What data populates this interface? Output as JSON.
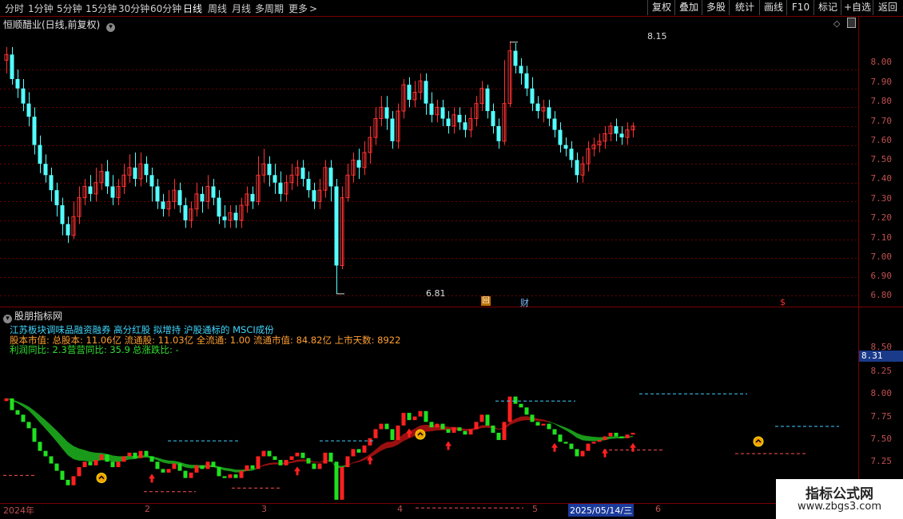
{
  "toolbar": {
    "periods": [
      "分时",
      "1分钟",
      "5分钟",
      "15分钟",
      "30分钟",
      "60分钟",
      "日线",
      "周线",
      "月线",
      "多周期",
      "更多"
    ],
    "active_period": "日线",
    "more_arrow": ">",
    "buttons": [
      "复权",
      "叠加",
      "多股",
      "统计",
      "画线",
      "F10",
      "标记",
      "+自选",
      "返回"
    ]
  },
  "main_chart": {
    "title": "恒顺醋业(日线,前复权)",
    "high_label": "8.15",
    "low_label": "6.81",
    "markers": [
      "回",
      "财",
      "$"
    ],
    "price_ticks": [
      "8.00",
      "7.90",
      "7.80",
      "7.70",
      "7.60",
      "7.50",
      "7.40",
      "7.30",
      "7.20",
      "7.10",
      "7.00",
      "6.90",
      "6.80"
    ]
  },
  "indicator": {
    "title": "股朋指标网",
    "line1": "江苏板块调味品融资融券 高分红股 拟增持 沪股通标的 MSCI成份",
    "line2": "股本市值: 总股本: 11.06亿 流通股: 11.03亿 全流通: 1.00 流通市值: 84.82亿 上市天数: 8922",
    "line3_a": "利润同比: 2.3",
    "line3_b": "营营同比: 35.9",
    "line3_c": "总涨跌比: -",
    "current_price": "8.31",
    "price_ticks": [
      "8.50",
      "8.25",
      "8.00",
      "7.75",
      "7.50",
      "7.25"
    ]
  },
  "x_axis": {
    "labels": [
      "2024年",
      "2",
      "3",
      "4",
      "5",
      "2025/05/14/三",
      "6"
    ]
  },
  "watermark": {
    "title": "指标公式网",
    "url": "www.zbgs3.com"
  },
  "colors": {
    "up": "#ff3232",
    "down": "#54ffff",
    "grid": "#6a0000",
    "axis_text": "#c05050",
    "ribbon_green": "#1a9a1a",
    "ribbon_red": "#9a1010"
  },
  "chart_data": {
    "type": "candlestick",
    "title": "恒顺醋业(日线,前复权)",
    "ylim": [
      6.78,
      8.2
    ],
    "y_ticks": [
      6.8,
      6.9,
      7.0,
      7.1,
      7.2,
      7.3,
      7.4,
      7.5,
      7.6,
      7.7,
      7.8,
      7.9,
      8.0
    ],
    "annotated_high": 8.15,
    "annotated_low": 6.81,
    "series": [
      {
        "name": "daily",
        "values": [
          [
            8.05,
            8.08,
            8.12,
            7.98
          ],
          [
            8.08,
            7.95,
            8.12,
            7.92
          ],
          [
            7.95,
            7.9,
            8.0,
            7.85
          ],
          [
            7.9,
            7.82,
            7.95,
            7.78
          ],
          [
            7.82,
            7.75,
            7.88,
            7.7
          ],
          [
            7.75,
            7.6,
            7.8,
            7.55
          ],
          [
            7.6,
            7.5,
            7.65,
            7.45
          ],
          [
            7.5,
            7.44,
            7.55,
            7.4
          ],
          [
            7.44,
            7.36,
            7.48,
            7.3
          ],
          [
            7.36,
            7.28,
            7.4,
            7.22
          ],
          [
            7.28,
            7.18,
            7.32,
            7.12
          ],
          [
            7.18,
            7.12,
            7.22,
            7.08
          ],
          [
            7.12,
            7.22,
            7.3,
            7.1
          ],
          [
            7.22,
            7.32,
            7.38,
            7.18
          ],
          [
            7.32,
            7.38,
            7.42,
            7.28
          ],
          [
            7.38,
            7.34,
            7.44,
            7.3
          ],
          [
            7.34,
            7.4,
            7.48,
            7.3
          ],
          [
            7.4,
            7.46,
            7.5,
            7.36
          ],
          [
            7.46,
            7.38,
            7.52,
            7.34
          ],
          [
            7.38,
            7.32,
            7.44,
            7.28
          ],
          [
            7.32,
            7.38,
            7.42,
            7.28
          ],
          [
            7.38,
            7.44,
            7.5,
            7.34
          ],
          [
            7.44,
            7.48,
            7.55,
            7.4
          ],
          [
            7.48,
            7.42,
            7.56,
            7.38
          ],
          [
            7.42,
            7.5,
            7.56,
            7.38
          ],
          [
            7.5,
            7.44,
            7.54,
            7.4
          ],
          [
            7.44,
            7.38,
            7.48,
            7.3
          ],
          [
            7.38,
            7.3,
            7.42,
            7.26
          ],
          [
            7.3,
            7.26,
            7.34,
            7.22
          ],
          [
            7.26,
            7.3,
            7.36,
            7.22
          ],
          [
            7.3,
            7.36,
            7.42,
            7.26
          ],
          [
            7.36,
            7.28,
            7.4,
            7.24
          ],
          [
            7.28,
            7.2,
            7.32,
            7.16
          ],
          [
            7.2,
            7.26,
            7.3,
            7.16
          ],
          [
            7.26,
            7.34,
            7.4,
            7.22
          ],
          [
            7.34,
            7.3,
            7.38,
            7.24
          ],
          [
            7.3,
            7.38,
            7.44,
            7.26
          ],
          [
            7.38,
            7.32,
            7.42,
            7.28
          ],
          [
            7.32,
            7.22,
            7.36,
            7.18
          ],
          [
            7.22,
            7.2,
            7.28,
            7.16
          ],
          [
            7.2,
            7.24,
            7.28,
            7.16
          ],
          [
            7.24,
            7.2,
            7.28,
            7.16
          ],
          [
            7.2,
            7.28,
            7.32,
            7.16
          ],
          [
            7.28,
            7.34,
            7.38,
            7.24
          ],
          [
            7.34,
            7.3,
            7.38,
            7.26
          ],
          [
            7.3,
            7.44,
            7.54,
            7.28
          ],
          [
            7.44,
            7.5,
            7.58,
            7.4
          ],
          [
            7.5,
            7.44,
            7.54,
            7.38
          ],
          [
            7.44,
            7.4,
            7.5,
            7.34
          ],
          [
            7.4,
            7.34,
            7.46,
            7.3
          ],
          [
            7.34,
            7.4,
            7.44,
            7.3
          ],
          [
            7.4,
            7.44,
            7.5,
            7.36
          ],
          [
            7.44,
            7.48,
            7.52,
            7.38
          ],
          [
            7.48,
            7.42,
            7.52,
            7.38
          ],
          [
            7.42,
            7.36,
            7.46,
            7.32
          ],
          [
            7.36,
            7.3,
            7.4,
            7.26
          ],
          [
            7.3,
            7.36,
            7.42,
            7.26
          ],
          [
            7.36,
            7.48,
            7.52,
            7.32
          ],
          [
            7.48,
            7.38,
            7.52,
            7.3
          ],
          [
            7.38,
            6.96,
            7.42,
            6.81
          ],
          [
            6.96,
            7.32,
            7.38,
            6.94
          ],
          [
            7.32,
            7.44,
            7.5,
            7.3
          ],
          [
            7.44,
            7.52,
            7.56,
            7.4
          ],
          [
            7.52,
            7.48,
            7.58,
            7.42
          ],
          [
            7.48,
            7.56,
            7.62,
            7.44
          ],
          [
            7.56,
            7.64,
            7.7,
            7.5
          ],
          [
            7.64,
            7.74,
            7.8,
            7.6
          ],
          [
            7.74,
            7.8,
            7.86,
            7.7
          ],
          [
            7.8,
            7.74,
            7.86,
            7.68
          ],
          [
            7.74,
            7.62,
            7.78,
            7.58
          ],
          [
            7.62,
            7.78,
            7.82,
            7.58
          ],
          [
            7.78,
            7.92,
            7.95,
            7.74
          ],
          [
            7.92,
            7.84,
            7.96,
            7.8
          ],
          [
            7.84,
            7.88,
            7.94,
            7.8
          ],
          [
            7.88,
            7.94,
            7.98,
            7.84
          ],
          [
            7.94,
            7.82,
            7.98,
            7.76
          ],
          [
            7.82,
            7.76,
            7.88,
            7.72
          ],
          [
            7.76,
            7.8,
            7.84,
            7.72
          ],
          [
            7.8,
            7.74,
            7.84,
            7.7
          ],
          [
            7.74,
            7.7,
            7.78,
            7.66
          ],
          [
            7.7,
            7.76,
            7.8,
            7.66
          ],
          [
            7.76,
            7.72,
            7.8,
            7.68
          ],
          [
            7.72,
            7.68,
            7.76,
            7.64
          ],
          [
            7.68,
            7.74,
            7.8,
            7.64
          ],
          [
            7.74,
            7.82,
            7.86,
            7.7
          ],
          [
            7.82,
            7.9,
            7.94,
            7.78
          ],
          [
            7.9,
            7.78,
            7.92,
            7.74
          ],
          [
            7.78,
            7.7,
            7.82,
            7.66
          ],
          [
            7.7,
            7.62,
            7.74,
            7.58
          ],
          [
            7.62,
            7.82,
            8.05,
            7.6
          ],
          [
            7.82,
            8.1,
            8.15,
            7.8
          ],
          [
            8.1,
            8.02,
            8.14,
            7.98
          ],
          [
            8.02,
            7.98,
            8.06,
            7.92
          ],
          [
            7.98,
            7.9,
            8.02,
            7.86
          ],
          [
            7.9,
            7.82,
            7.96,
            7.78
          ],
          [
            7.82,
            7.78,
            7.86,
            7.74
          ],
          [
            7.78,
            7.8,
            7.84,
            7.72
          ],
          [
            7.8,
            7.74,
            7.84,
            7.7
          ],
          [
            7.74,
            7.68,
            7.78,
            7.64
          ],
          [
            7.68,
            7.6,
            7.72,
            7.56
          ],
          [
            7.6,
            7.58,
            7.64,
            7.54
          ],
          [
            7.58,
            7.52,
            7.62,
            7.48
          ],
          [
            7.52,
            7.44,
            7.56,
            7.4
          ],
          [
            7.44,
            7.5,
            7.54,
            7.4
          ],
          [
            7.5,
            7.58,
            7.62,
            7.46
          ],
          [
            7.58,
            7.6,
            7.64,
            7.54
          ],
          [
            7.6,
            7.62,
            7.66,
            7.56
          ],
          [
            7.62,
            7.66,
            7.7,
            7.58
          ],
          [
            7.66,
            7.7,
            7.72,
            7.62
          ],
          [
            7.7,
            7.66,
            7.74,
            7.62
          ],
          [
            7.66,
            7.64,
            7.7,
            7.6
          ],
          [
            7.64,
            7.68,
            7.72,
            7.6
          ],
          [
            7.68,
            7.7,
            7.72,
            7.64
          ]
        ]
      }
    ],
    "indicator_ylim": [
      7.1,
      8.6
    ],
    "indicator_current": 8.31
  }
}
